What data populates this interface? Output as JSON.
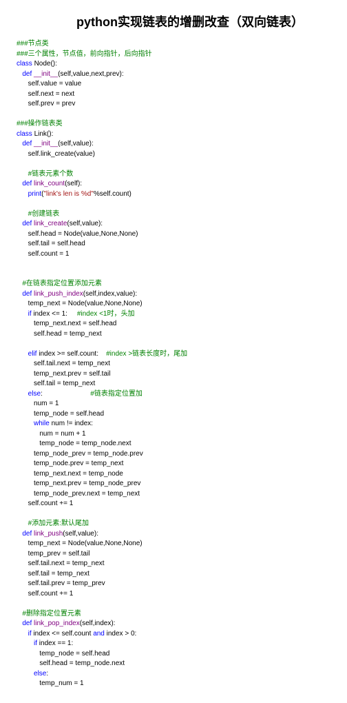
{
  "title": "python实现链表的增删改查（双向链表）",
  "code": {
    "c1": "###节点类",
    "c2": "###三个属性，节点值，前向指针，后向指针",
    "kw_class1": "class",
    "cls1": " Node():",
    "kw_def1": "def",
    "fn1": " __init__",
    "p1": "(self,value,next,prev):",
    "l1": "      self.value = value",
    "l2": "      self.next = next",
    "l3": "      self.prev = prev",
    "c3": "###操作链表类",
    "kw_class2": "class",
    "cls2": " Link():",
    "kw_def2": "def",
    "fn2": " __init__",
    "p2": "(self,value):",
    "l4": "      self.link_create(value)",
    "c4": "#链表元素个数",
    "kw_def3": "def",
    "fn3": " link_count",
    "p3": "(self):",
    "pr1": "print",
    "st1": "\"link's len is %d\"",
    "pr1b": "%self.count)",
    "c5": "#创建链表",
    "kw_def4": "def",
    "fn4": " link_create",
    "p4": "(self,value):",
    "l5": "      self.head = Node(value,None,None)",
    "l6": "      self.tail = self.head",
    "l7": "      self.count = 1",
    "c6": "#在链表指定位置添加元素",
    "kw_def5": "def",
    "fn5": " link_push_index",
    "p5": "(self,index,value):",
    "l8": "      temp_next = Node(value,None,None)",
    "kw_if1": "if",
    "l9": " index <= 1:     ",
    "c7": "#index <1时，头加",
    "l10": "         temp_next.next = self.head",
    "l11": "         self.head = temp_next",
    "kw_elif": "elif",
    "l12": " index >= self.count:    ",
    "c8": "#index >链表长度时，尾加",
    "l13": "         self.tail.next = temp_next",
    "l14": "         temp_next.prev = self.tail",
    "l15": "         self.tail = temp_next",
    "kw_else1": "else",
    "l16": ":                         ",
    "c9": "#链表指定位置加",
    "l17": "         num = 1",
    "l18": "         temp_node = self.head",
    "kw_while": "while",
    "l19": " num != index:",
    "l20": "            num = num + 1",
    "l21": "            temp_node = temp_node.next",
    "l22": "         temp_node_prev = temp_node.prev",
    "l23": "         temp_node.prev = temp_next",
    "l24": "         temp_next.next = temp_node",
    "l25": "         temp_next.prev = temp_node_prev",
    "l26": "         temp_node_prev.next = temp_next",
    "l27": "      self.count += 1",
    "c10": "#添加元素:默认尾加",
    "kw_def6": "def",
    "fn6": " link_push",
    "p6": "(self,value):",
    "l28": "      temp_next = Node(value,None,None)",
    "l29": "      temp_prev = self.tail",
    "l30": "      self.tail.next = temp_next",
    "l31": "      self.tail = temp_next",
    "l32": "      self.tail.prev = temp_prev",
    "l33": "      self.count += 1",
    "c11": "#删除指定位置元素",
    "kw_def7": "def",
    "fn7": " link_pop_index",
    "p7": "(self,index):",
    "kw_if2": "if",
    "l34": " index <= self.count ",
    "kw_and": "and",
    "l34b": " index > 0:",
    "kw_if3": "if",
    "l35": " index == 1:",
    "l36": "            temp_node = self.head",
    "l37": "            self.head = temp_node.next",
    "kw_else2": "else",
    "l38": ":",
    "l39": "            temp_num = 1"
  }
}
